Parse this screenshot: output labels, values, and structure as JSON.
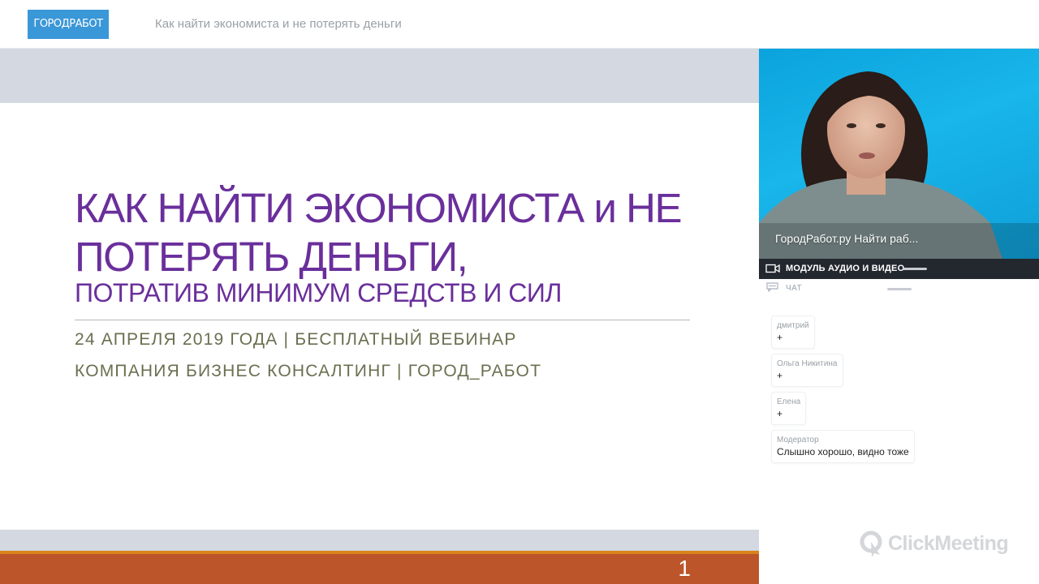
{
  "header": {
    "logo_text": "ГОРОДРАБОТ",
    "title": "Как найти экономиста и не потерять деньги"
  },
  "slide": {
    "title_line1": "КАК НАЙТИ ЭКОНОМИСТА и НЕ",
    "title_line2": "ПОТЕРЯТЬ ДЕНЬГИ,",
    "subtitle": "ПОТРАТИВ МИНИМУМ СРЕДСТВ И СИЛ",
    "date_line": "24 АПРЕЛЯ 2019 ГОДА | БЕСПЛАТНЫЙ ВЕБИНАР",
    "company_line": "КОМПАНИЯ БИЗНЕС КОНСАЛТИНГ | ГОРОД_РАБОТ",
    "page_number": "1"
  },
  "video": {
    "caption": "ГородРабот.ру Найти раб..."
  },
  "module": {
    "label": "МОДУЛЬ АУДИО И ВИДЕО"
  },
  "chat": {
    "label": "ЧАТ",
    "messages": [
      {
        "author": "дмитрий",
        "text": "+"
      },
      {
        "author": "Ольга Никитина",
        "text": "+"
      },
      {
        "author": "Елена",
        "text": "+"
      },
      {
        "author": "Модератор",
        "text": "Слышно хорошо, видно тоже"
      }
    ]
  },
  "brand": {
    "name": "ClickMeeting"
  },
  "colors": {
    "slide_title": "#6a2f9b",
    "slide_sub": "#6b6f50",
    "footer_bar": "#bc552a",
    "footer_accent": "#d9841c",
    "logo_bg": "#3a97d8",
    "video_bg": "#18b6ea"
  }
}
